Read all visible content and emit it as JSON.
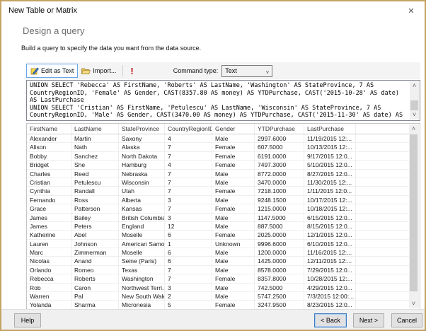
{
  "window": {
    "title": "New Table or Matrix",
    "close_icon": "✕"
  },
  "header": {
    "title": "Design a query",
    "subtitle": "Build a query to specify the data you want from the data source."
  },
  "toolbar": {
    "edit_as_text_label": "Edit as Text",
    "import_label": "Import...",
    "run_icon": "!",
    "command_type_label": "Command type:",
    "command_type_value": "Text",
    "chevron_icon": "˅"
  },
  "sql": {
    "lines": [
      "UNION SELECT 'Rebecca' AS FirstName, 'Roberts' AS LastName, 'Washington' AS StateProvince, 7 AS",
      "CountryRegionID, 'Female' AS Gender, CAST(8357.80 AS money) AS YTDPurchase, CAST('2015-10-28' AS date)",
      "AS LastPurchase",
      "UNION SELECT 'Cristian' AS FirstName, 'Petulescu' AS LastName, 'Wisconsin' AS StateProvince, 7 AS",
      "CountryRegionID, 'Male' AS Gender, CAST(3470.00 AS money) AS YTDPurchase, CAST('2015-11-30' AS date) AS"
    ]
  },
  "grid": {
    "columns": [
      "FirstName",
      "LastName",
      "StateProvince",
      "CountryRegionID",
      "Gender",
      "YTDPurchase",
      "LastPurchase"
    ],
    "rows": [
      [
        "Alexander",
        "Martin",
        "Saxony",
        "4",
        "Male",
        "2997.6000",
        "11/19/2015 12:..."
      ],
      [
        "Alison",
        "Nath",
        "Alaska",
        "7",
        "Female",
        "607.5000",
        "10/13/2015 12:..."
      ],
      [
        "Bobby",
        "Sanchez",
        "North Dakota",
        "7",
        "Female",
        "6191.0000",
        "9/17/2015 12:0..."
      ],
      [
        "Bridget",
        "She",
        "Hamburg",
        "4",
        "Female",
        "7497.3000",
        "5/10/2015 12:0..."
      ],
      [
        "Charles",
        "Reed",
        "Nebraska",
        "7",
        "Male",
        "8772.0000",
        "8/27/2015 12:0..."
      ],
      [
        "Cristian",
        "Petulescu",
        "Wisconsin",
        "7",
        "Male",
        "3470.0000",
        "11/30/2015 12:..."
      ],
      [
        "Cynthia",
        "Randall",
        "Utah",
        "7",
        "Female",
        "7218.1000",
        "1/11/2015 12:0..."
      ],
      [
        "Fernando",
        "Ross",
        "Alberta",
        "3",
        "Male",
        "9248.1500",
        "10/17/2015 12:..."
      ],
      [
        "Grace",
        "Patterson",
        "Kansas",
        "7",
        "Female",
        "1215.0000",
        "10/18/2015 12:..."
      ],
      [
        "James",
        "Bailey",
        "British Columbia",
        "3",
        "Male",
        "1147.5000",
        "6/15/2015 12:0..."
      ],
      [
        "James",
        "Peters",
        "England",
        "12",
        "Male",
        "887.5000",
        "8/15/2015 12:0..."
      ],
      [
        "Katherine",
        "Abel",
        "Moselle",
        "6",
        "Female",
        "2025.0000",
        "12/1/2015 12:0..."
      ],
      [
        "Lauren",
        "Johnson",
        "American Samoa",
        "1",
        "Unknown",
        "9996.6000",
        "6/10/2015 12:0..."
      ],
      [
        "Marc",
        "Zimmerman",
        "Moselle",
        "6",
        "Male",
        "1200.0000",
        "11/16/2015 12:..."
      ],
      [
        "Nicolas",
        "Anand",
        "Seine (Paris)",
        "6",
        "Male",
        "1425.0000",
        "12/11/2015 12:..."
      ],
      [
        "Orlando",
        "Romeo",
        "Texas",
        "7",
        "Male",
        "8578.0000",
        "7/29/2015 12:0..."
      ],
      [
        "Rebecca",
        "Roberts",
        "Washington",
        "7",
        "Female",
        "8357.8000",
        "10/28/2015 12:..."
      ],
      [
        "Rob",
        "Caron",
        "Northwest Terri...",
        "3",
        "Male",
        "742.5000",
        "4/29/2015 12:0..."
      ],
      [
        "Warren",
        "Pal",
        "New South Wales",
        "2",
        "Male",
        "5747.2500",
        "7/3/2015 12:00:..."
      ],
      [
        "Yolanda",
        "Sharma",
        "Micronesia",
        "5",
        "Female",
        "3247.9500",
        "8/23/2015 12:0..."
      ]
    ]
  },
  "scrollbar": {
    "up_icon": "˄",
    "down_icon": "˅"
  },
  "footer": {
    "help_label": "Help",
    "back_label": "< Back",
    "next_label": "Next >",
    "cancel_label": "Cancel"
  },
  "colors": {
    "accent": "#0078d7",
    "dialog_border": "#c3a264",
    "error_red": "#c00000",
    "toolbar_bg": "#f4f4f4",
    "footer_bg": "#f0f0f0"
  }
}
